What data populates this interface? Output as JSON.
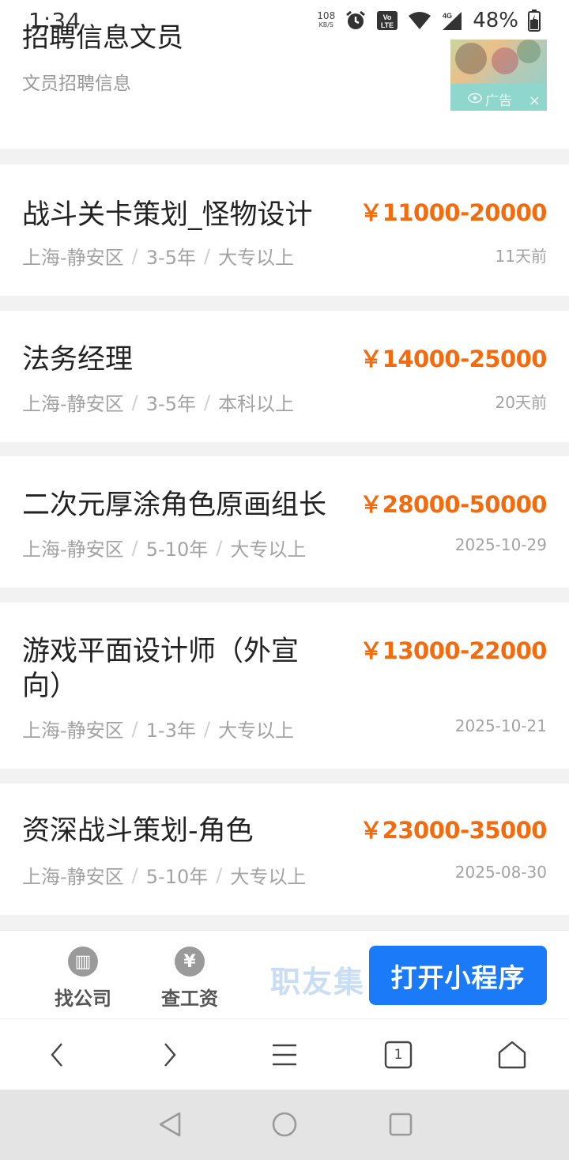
{
  "status_bar": {
    "time": "1:34",
    "net_speed_value": "108",
    "net_speed_unit": "KB/S",
    "battery_percent": "48%"
  },
  "ad": {
    "title": "招聘信息文员",
    "subtitle": "文员招聘信息",
    "badge_label": "广告",
    "close_label": "×"
  },
  "jobs": [
    {
      "title": "战斗关卡策划_怪物设计",
      "salary": "￥11000-20000",
      "location": "上海-静安区",
      "experience": "3-5年",
      "education": "大专以上",
      "posted": "11天前"
    },
    {
      "title": "法务经理",
      "salary": "￥14000-25000",
      "location": "上海-静安区",
      "experience": "3-5年",
      "education": "本科以上",
      "posted": "20天前"
    },
    {
      "title": "二次元厚涂角色原画组长",
      "salary": "￥28000-50000",
      "location": "上海-静安区",
      "experience": "5-10年",
      "education": "大专以上",
      "posted": "2025-10-29"
    },
    {
      "title": "游戏平面设计师（外宣向）",
      "salary": "￥13000-22000",
      "location": "上海-静安区",
      "experience": "1-3年",
      "education": "大专以上",
      "posted": "2025-10-21"
    },
    {
      "title": "资深战斗策划-角色",
      "salary": "￥23000-35000",
      "location": "上海-静安区",
      "experience": "5-10年",
      "education": "大专以上",
      "posted": "2025-08-30"
    }
  ],
  "meta_separator": "/",
  "promo": {
    "find_company_label": "找公司",
    "find_company_icon_glyph": "▥",
    "check_salary_label": "查工资",
    "check_salary_icon_glyph": "¥",
    "brand": "职友集",
    "open_button_label": "打开小程序"
  },
  "browser_toolbar": {
    "tab_count": "1"
  },
  "colors": {
    "salary": "#f26b0f",
    "primary_button": "#1a7af8",
    "brand_logo": "#c9ddf5",
    "meta_text": "#a3a3a3"
  }
}
